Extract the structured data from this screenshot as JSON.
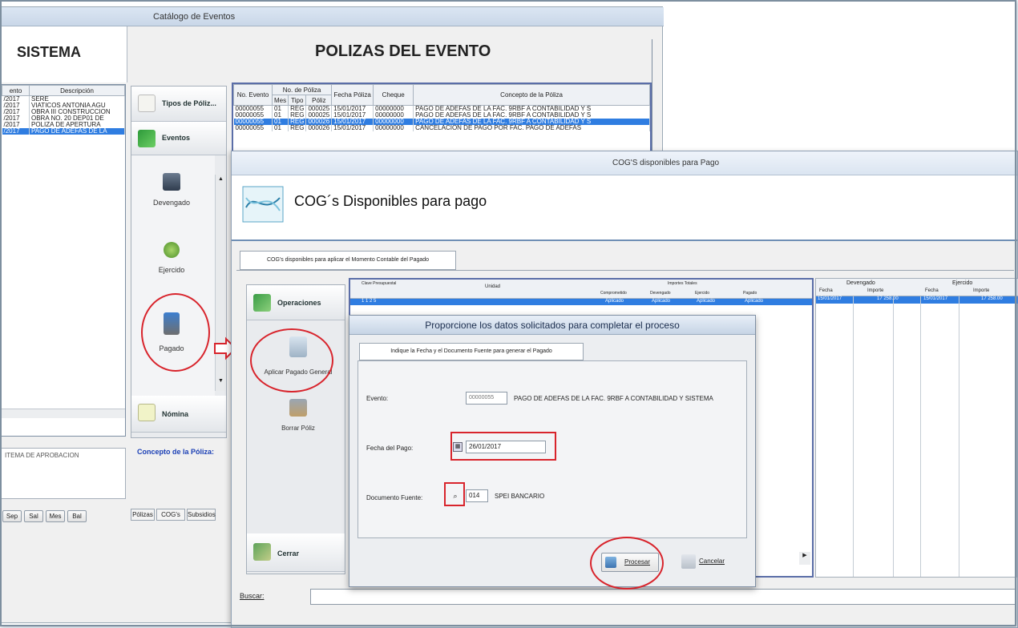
{
  "window1": {
    "title": "Catálogo de Eventos",
    "left_header": "SISTEMA",
    "center_header": "POLIZAS DEL EVENTO",
    "events_table": {
      "headers": [
        "ento",
        "Descripción"
      ],
      "rows": [
        [
          "/2017",
          "SERE"
        ],
        [
          "/2017",
          "VIATICOS ANTONIA AGU"
        ],
        [
          "/2017",
          "OBRA III CONSTRUCCION"
        ],
        [
          "/2017",
          "OBRA NO. 20 DEP01 DE"
        ],
        [
          "/2017",
          "POLIZA DE APERTURA"
        ],
        [
          "/2017",
          "PAGO DE ADEFAS DE LA"
        ]
      ],
      "selected_index": 5
    },
    "side_buttons": {
      "tipos_poliza": "Tipos de Póliz...",
      "eventos": "Eventos",
      "nomina": "Nómina"
    },
    "tools": {
      "devengado": "Devengado",
      "ejercido": "Ejercido",
      "pagado": "Pagado"
    },
    "polizas_table": {
      "headers": [
        "No. Evento",
        "No. de Póliza",
        "Fecha Póliza",
        "Cheque",
        "Concepto de la Póliza"
      ],
      "subheaders": [
        "Mes",
        "Tipo",
        "Póliz"
      ],
      "rows": [
        [
          "00000055",
          "01",
          "REG",
          "000025",
          "15/01/2017",
          "00000000",
          "PAGO DE ADEFAS DE LA FAC. 9RBF A CONTABILIDAD Y S"
        ],
        [
          "00000055",
          "01",
          "REG",
          "000025",
          "15/01/2017",
          "00000000",
          "PAGO DE ADEFAS DE LA FAC. 9RBF A CONTABILIDAD Y S"
        ],
        [
          "00000055",
          "01",
          "REG",
          "000026",
          "15/01/2017",
          "00000000",
          "PAGO DE ADEFAS DE LA FAC. 9RBF A CONTABILIDAD Y S"
        ],
        [
          "00000055",
          "01",
          "REG",
          "000026",
          "15/01/2017",
          "00000000",
          "CANCELACION DE PAGO POR FAC. PAGO DE ADEFAS"
        ]
      ],
      "selected_index": 2
    },
    "left_memo": "ITEMA DE APROBACION",
    "concepto_label": "Concepto de la Póliza:",
    "bottom_buttons": [
      "Sep",
      "Sal",
      "Mes",
      "Bal"
    ],
    "bottom_tabs": [
      "Pólizas",
      "COG's",
      "Subsidios"
    ]
  },
  "window2": {
    "title": "COG'S disponibles para Pago",
    "header": "COG´s Disponibles para pago",
    "tab": "COG's disponibles para aplicar el Momento Contable del Pagado",
    "side_buttons": {
      "operaciones": "Operaciones",
      "cerrar": "Cerrar"
    },
    "tools": {
      "aplicar": "Aplicar Pagado General",
      "borrar": "Borrar Póliz"
    },
    "grid_headers": {
      "clave": "Clave Presupuestal",
      "unidad": "Unidad",
      "importes": "Importes Totales",
      "comprometido": "Comprometido",
      "devengado_col": "Devengado",
      "ejercido_col": "Ejercido",
      "pagado_col": "Pagado",
      "devengado_group": "Devengado",
      "ejercido_group": "Ejercido",
      "fecha": "Fecha",
      "importe": "Importe"
    },
    "grid_row": [
      "1 1 2 5",
      "Aplicado",
      "Aplicado",
      "Aplicado",
      "Aplicado"
    ],
    "right_row": [
      "15/01/2017",
      "17 258.00",
      "15/01/2017",
      "17 258.00"
    ],
    "buscar_label": "Buscar:",
    "buscar_value": ""
  },
  "dialog": {
    "title": "Proporcione los datos solicitados para completar el proceso",
    "tab": "Indique la Fecha y el Documento Fuente para generar el Pagado",
    "evento_label": "Evento:",
    "evento_code": "00000055",
    "evento_desc": "PAGO DE ADEFAS DE LA FAC. 9RBF A CONTABILIDAD Y SISTEMA",
    "fecha_label": "Fecha del Pago:",
    "fecha_value": "26/01/2017",
    "doc_label": "Documento Fuente:",
    "doc_value": "014",
    "doc_desc": "SPEI BANCARIO",
    "procesar": "Procesar",
    "cancelar": "Cancelar"
  },
  "colors": {
    "highlight": "#d8242c",
    "selection": "#2f7de1"
  }
}
